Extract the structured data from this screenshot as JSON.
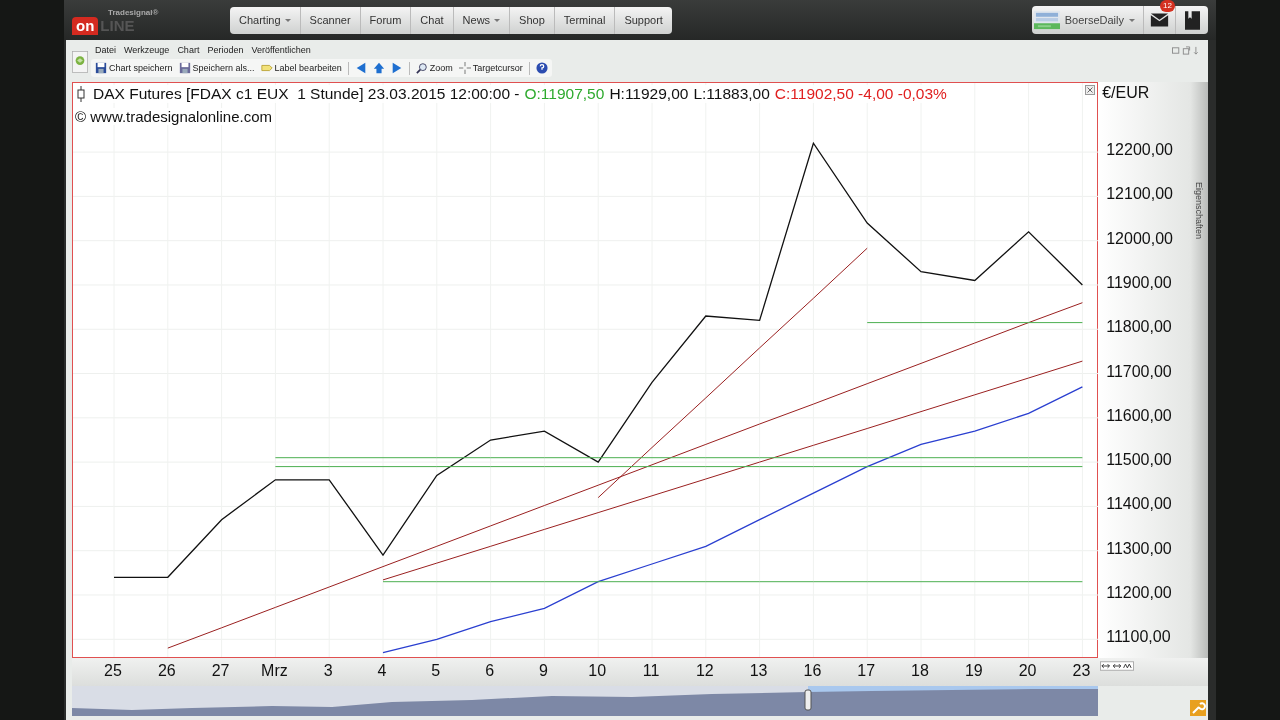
{
  "header": {
    "logo": {
      "brand": "Tradesignal®",
      "badge": "on",
      "word": "LINE"
    },
    "nav": [
      {
        "label": "Charting",
        "dropdown": true
      },
      {
        "label": "Scanner",
        "dropdown": false
      },
      {
        "label": "Forum",
        "dropdown": false
      },
      {
        "label": "Chat",
        "dropdown": false
      },
      {
        "label": "News",
        "dropdown": true
      },
      {
        "label": "Shop",
        "dropdown": false
      },
      {
        "label": "Terminal",
        "dropdown": false
      },
      {
        "label": "Support",
        "dropdown": false
      }
    ],
    "user": {
      "name": "BoerseDaily",
      "kind": "picture"
    },
    "mail_badge": "12"
  },
  "menu": [
    "Datei",
    "Werkzeuge",
    "Chart",
    "Perioden",
    "Veröffentlichen"
  ],
  "toolbar": [
    {
      "kind": "save",
      "label": "Chart speichern"
    },
    {
      "kind": "saveas",
      "label": "Speichern als..."
    },
    {
      "kind": "label",
      "label": "Label bearbeiten"
    },
    {
      "kind": "sep"
    },
    {
      "kind": "left"
    },
    {
      "kind": "up"
    },
    {
      "kind": "right"
    },
    {
      "kind": "sep"
    },
    {
      "kind": "zoom",
      "label": "Zoom"
    },
    {
      "kind": "cursor",
      "label": "Targetcursor"
    },
    {
      "kind": "sep"
    },
    {
      "kind": "help"
    }
  ],
  "chart": {
    "title_parts": [
      {
        "text": "DAX Futures [FDAX c1 EUX  1 Stunde] 23.03.2015 12:00:00 -",
        "color": "#111111"
      },
      {
        "text": "O:11907,50",
        "color": "#2eaa2e"
      },
      {
        "text": "H:11929,00",
        "color": "#111111"
      },
      {
        "text": "L:11883,00",
        "color": "#111111"
      },
      {
        "text": "C:11902,50 -4,00 -0,03%",
        "color": "#e02020"
      }
    ],
    "copyright": "© www.tradesignalonline.com",
    "axis_title": "€/EUR",
    "side_tab": "Eigenschaften",
    "chart_data": {
      "type": "line",
      "grid": true,
      "ylim": [
        11060,
        12356
      ],
      "yticks": [
        {
          "value": 11100,
          "label": "11100,00"
        },
        {
          "value": 11200,
          "label": "11200,00"
        },
        {
          "value": 11300,
          "label": "11300,00"
        },
        {
          "value": 11400,
          "label": "11400,00"
        },
        {
          "value": 11500,
          "label": "11500,00"
        },
        {
          "value": 11600,
          "label": "11600,00"
        },
        {
          "value": 11700,
          "label": "11700,00"
        },
        {
          "value": 11800,
          "label": "11800,00"
        },
        {
          "value": 11900,
          "label": "11900,00"
        },
        {
          "value": 12000,
          "label": "12000,00"
        },
        {
          "value": 12100,
          "label": "12100,00"
        },
        {
          "value": 12200,
          "label": "12200,00"
        }
      ],
      "categories": [
        "25",
        "26",
        "27",
        "Mrz",
        "3",
        "4",
        "5",
        "6",
        "9",
        "10",
        "11",
        "12",
        "13",
        "16",
        "17",
        "18",
        "19",
        "20",
        "23"
      ],
      "series": [
        {
          "color": "#111111",
          "values": [
            11240,
            11240,
            11370,
            11460,
            11460,
            11290,
            11470,
            11550,
            11570,
            11500,
            11680,
            11830,
            11820,
            12220,
            12040,
            11930,
            11910,
            12020,
            11900
          ]
        },
        {
          "color": "#2a3fd0",
          "values": [
            null,
            null,
            null,
            null,
            null,
            11070,
            11100,
            11140,
            11170,
            11230,
            11270,
            11310,
            11370,
            11430,
            11490,
            11540,
            11570,
            11610,
            11670
          ]
        },
        {
          "color": "#9a2020",
          "values": [
            null,
            11080,
            11126,
            11172,
            11218,
            11264,
            11310,
            11356,
            11402,
            11448,
            11494,
            11540,
            11586,
            11631,
            11677,
            11723,
            11769,
            11815,
            11860
          ]
        },
        {
          "color": "#9a2020",
          "values": [
            null,
            null,
            null,
            null,
            null,
            11234,
            11272,
            11310,
            11348,
            11386,
            11424,
            11462,
            11500,
            11538,
            11576,
            11614,
            11652,
            11690,
            11728
          ]
        },
        {
          "color": "#9a2020",
          "values": [
            null,
            null,
            null,
            null,
            null,
            null,
            null,
            null,
            null,
            11420,
            11533,
            11645,
            11758,
            11870,
            11983,
            null,
            null,
            null,
            null
          ]
        },
        {
          "color": "#4caf50",
          "values": [
            null,
            null,
            null,
            null,
            null,
            null,
            null,
            null,
            null,
            null,
            null,
            null,
            null,
            null,
            11815,
            11815,
            11815,
            11815,
            11815
          ]
        },
        {
          "color": "#4caf50",
          "values": [
            null,
            null,
            null,
            11490,
            11490,
            11490,
            11490,
            11490,
            11490,
            11490,
            11490,
            11490,
            11490,
            11490,
            11490,
            11490,
            11490,
            11490,
            11490
          ]
        },
        {
          "color": "#4caf50",
          "values": [
            null,
            null,
            null,
            11510,
            11510,
            11510,
            11510,
            11510,
            11510,
            11510,
            11510,
            11510,
            11510,
            11510,
            11510,
            11510,
            11510,
            11510,
            11510
          ]
        },
        {
          "color": "#4caf50",
          "values": [
            null,
            null,
            null,
            null,
            null,
            11230,
            11230,
            11230,
            11230,
            11230,
            11230,
            11230,
            11230,
            11230,
            11230,
            11230,
            11230,
            11230,
            11230
          ]
        }
      ]
    }
  }
}
